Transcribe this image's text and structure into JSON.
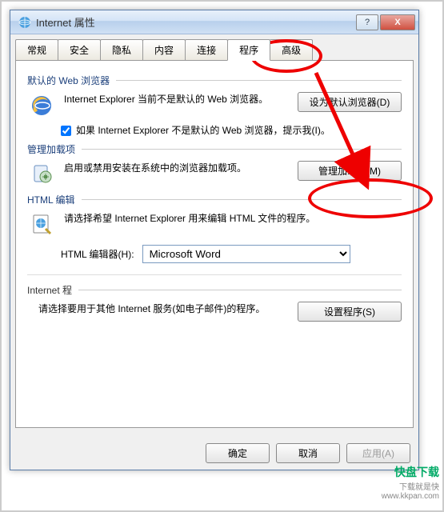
{
  "window": {
    "title": "Internet 属性",
    "help_btn": "?",
    "close_btn": "X"
  },
  "tabs": {
    "items": [
      {
        "label": "常规"
      },
      {
        "label": "安全"
      },
      {
        "label": "隐私"
      },
      {
        "label": "内容"
      },
      {
        "label": "连接"
      },
      {
        "label": "程序"
      },
      {
        "label": "高级"
      }
    ],
    "active_index": 5
  },
  "sections": {
    "default_browser": {
      "title": "默认的 Web 浏览器",
      "text": "Internet Explorer 当前不是默认的 Web 浏览器。",
      "button": "设为默认浏览器(D)",
      "checkbox_label": "如果 Internet Explorer 不是默认的 Web 浏览器，提示我(I)。",
      "checkbox_checked": true
    },
    "addons": {
      "title": "管理加载项",
      "text": "启用或禁用安装在系统中的浏览器加载项。",
      "button": "管理加载项(M)"
    },
    "html_edit": {
      "title": "HTML 编辑",
      "text": "请选择希望 Internet Explorer 用来编辑 HTML 文件的程序。",
      "editor_label": "HTML 编辑器(H):",
      "editor_value": "Microsoft Word"
    },
    "internet_programs": {
      "title": "Internet 程",
      "text": "请选择要用于其他 Internet 服务(如电子邮件)的程序。",
      "button": "设置程序(S)"
    }
  },
  "footer": {
    "ok": "确定",
    "cancel": "取消",
    "apply": "应用(A)"
  },
  "watermark": {
    "brand": "快盘下载",
    "tagline": "下载就是快",
    "url": "www.kkpan.com"
  }
}
